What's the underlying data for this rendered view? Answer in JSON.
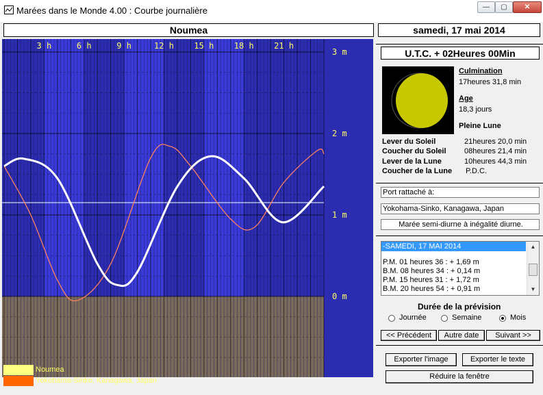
{
  "window": {
    "title": "Marées dans le Monde 4.00 : Courbe journalière",
    "minimize": "—",
    "maximize": "▢",
    "close": "✕"
  },
  "header": {
    "location": "Noumea",
    "date": "samedi, 17 mai 2014"
  },
  "chart": {
    "hour_labels": [
      "3 h",
      "6 h",
      "9 h",
      "12 h",
      "15 h",
      "18 h",
      "21 h"
    ],
    "y_labels": [
      "3 m",
      "2 m",
      "1 m",
      "0 m"
    ],
    "legend": [
      {
        "label": "Noumea",
        "color": "#ffff80"
      },
      {
        "label": "Yokohama-Sinko, Kanagawa, Japan",
        "color": "#ff6600"
      }
    ]
  },
  "chart_data": {
    "type": "line",
    "x_unit": "h",
    "xlim": [
      0,
      24
    ],
    "ylim": [
      0,
      3
    ],
    "grid": true,
    "series": [
      {
        "name": "Noumea",
        "color": "#ffffff",
        "x": [
          0,
          1.5,
          4,
          7,
          8.5,
          10,
          13,
          15.5,
          18,
          20.9,
          24
        ],
        "y": [
          1.6,
          1.69,
          1.45,
          0.4,
          0.14,
          0.3,
          1.35,
          1.72,
          1.45,
          0.91,
          1.35
        ]
      },
      {
        "name": "Yokohama-Sinko, Kanagawa, Japan",
        "color": "#ff8060",
        "x": [
          0,
          2,
          4,
          5.5,
          8,
          11,
          12.5,
          14,
          17,
          18.8,
          21,
          23.5,
          24
        ],
        "y": [
          1.6,
          1.0,
          0.2,
          -0.05,
          0.4,
          1.7,
          1.84,
          1.6,
          0.95,
          0.85,
          1.4,
          1.79,
          1.75
        ]
      }
    ]
  },
  "info": {
    "utc": "U.T.C. + 02Heures 00Min",
    "culmination_label": "Culmination",
    "culmination_value": "17heures 31,8 min",
    "age_label": "Age",
    "age_value": "18,3 jours",
    "phase": "Pleine Lune",
    "sun_moon": [
      {
        "label": "Lever du Soleil",
        "value": "21heures 20,0 min"
      },
      {
        "label": "Coucher du Soleil",
        "value": "08heures 21,4 min"
      },
      {
        "label": "Lever de la Lune",
        "value": "10heures 44,3 min"
      },
      {
        "label": "Coucher de la Lune",
        "value": "P.D.C."
      }
    ]
  },
  "port": {
    "label": "Port rattaché à:",
    "name": "Yokohama-Sinko, Kanagawa, Japan",
    "tide_type": "Marée semi-diurne à inégalité diurne."
  },
  "tides": {
    "header": "-SAMEDI, 17 MAI 2014",
    "items": [
      "P.M. 01 heures 36 : + 1,69  m",
      "B.M. 08 heures 34 : + 0,14  m",
      "P.M. 15 heures 31 : + 1,72  m",
      "B.M. 20 heures 54 : + 0,91  m"
    ]
  },
  "forecast": {
    "title": "Durée de la prévision",
    "options": [
      "Journée",
      "Semaine",
      "Mois"
    ],
    "selected": "Mois"
  },
  "buttons": {
    "prev": "<< Précédent",
    "other_date": "Autre date",
    "next": "Suivant >>",
    "export_image": "Exporter l'image",
    "export_text": "Exporter le texte",
    "reduce": "Réduire la fenêtre"
  },
  "colors": {
    "chart_bg": "#2c2cb0",
    "day_band": "#3a3ad8",
    "land": "#7a6a5c",
    "moon": "#c8c800"
  }
}
